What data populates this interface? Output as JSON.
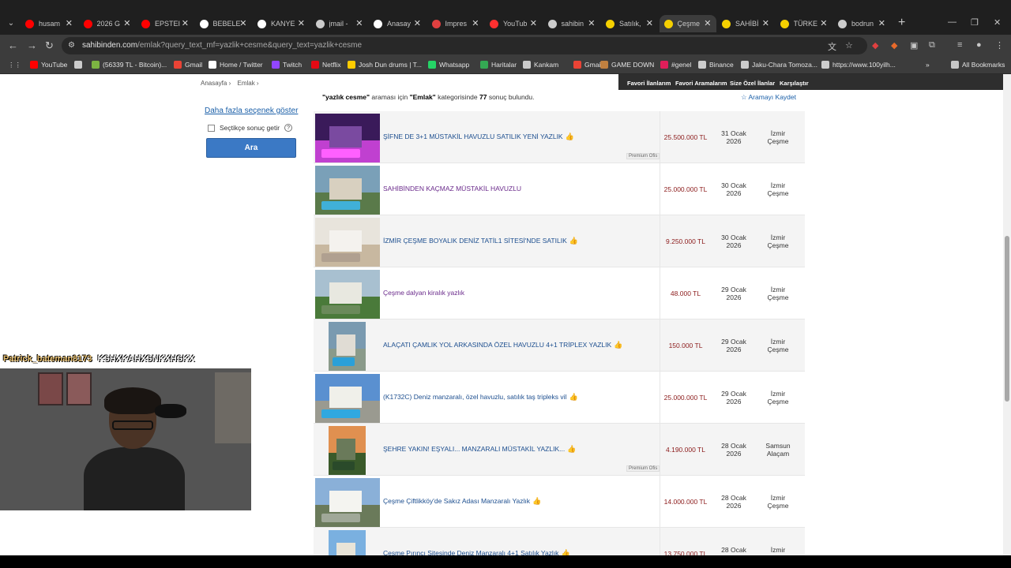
{
  "tabs": [
    {
      "label": "husam",
      "color": "#ff0000"
    },
    {
      "label": "2026 G",
      "color": "#ff0000"
    },
    {
      "label": "EPSTEI",
      "color": "#ff0000"
    },
    {
      "label": "BEBELE",
      "color": "#ffffff"
    },
    {
      "label": "KANYE",
      "color": "#ffffff"
    },
    {
      "label": "jmail -",
      "color": "#cccccc"
    },
    {
      "label": "Anasay",
      "color": "#ffffff"
    },
    {
      "label": "Impres",
      "color": "#e04040"
    },
    {
      "label": "YouTub",
      "color": "#ff3030"
    },
    {
      "label": "sahibin",
      "color": "#cccccc"
    },
    {
      "label": "Satılık,",
      "color": "#f5d000"
    },
    {
      "label": "Çeşme",
      "color": "#f5d000"
    },
    {
      "label": "SAHİBİ",
      "color": "#f5d000"
    },
    {
      "label": "TÜRKE",
      "color": "#f5d000"
    },
    {
      "label": "bodrun",
      "color": "#cccccc"
    }
  ],
  "address": {
    "domain": "sahibinden.com",
    "path": "/emlak?query_text_mf=yazlik+cesme&query_text=yazlik+cesme"
  },
  "bookmarks": [
    {
      "label": "YouTube",
      "color": "#ff0000"
    },
    {
      "label": "",
      "color": "#cccccc"
    },
    {
      "label": "(56339 TL - Bitcoin)...",
      "color": "#7cb342"
    },
    {
      "label": "Gmail",
      "color": "#ea4335"
    },
    {
      "label": "Home / Twitter",
      "color": "#ffffff"
    },
    {
      "label": "Twitch",
      "color": "#9146ff"
    },
    {
      "label": "Netflix",
      "color": "#e50914"
    },
    {
      "label": "Josh Dun drums | T...",
      "color": "#ffcc00"
    },
    {
      "label": "Whatsapp",
      "color": "#25d366"
    },
    {
      "label": "Haritalar",
      "color": "#34a853"
    },
    {
      "label": "Kankam",
      "color": "#cccccc"
    },
    {
      "label": "Gmail",
      "color": "#ea4335"
    },
    {
      "label": "GAME DOWN",
      "color": "#c08040"
    },
    {
      "label": "#genel",
      "color": "#e01e5a"
    },
    {
      "label": "Binance",
      "color": "#cccccc"
    },
    {
      "label": "Jaku-Chara Tomoza...",
      "color": "#cccccc"
    },
    {
      "label": "https://www.100yilh...",
      "color": "#cccccc"
    }
  ],
  "all_bookmarks": "All Bookmarks",
  "breadcrumb": [
    "Anasayfa ›",
    "Emlak ›"
  ],
  "topnav": [
    "Favori İlanlarım",
    "Favori Aramalarım",
    "Size Özel İlanlar",
    "Karşılaştır"
  ],
  "result_info": {
    "query": "\"yazlık cesme\"",
    "mid": " araması için ",
    "category": "\"Emlak\"",
    "mid2": " kategorisinde ",
    "count": "77",
    "tail": " sonuç bulundu."
  },
  "save_search": "☆ Aramayı Kaydet",
  "more_filters": "Daha fazla seçenek göster",
  "select_label": "Seçtikçe sonuç getir",
  "search_button": "Ara",
  "listings": [
    {
      "title": "ŞİFNE DE 3+1 MÜSTAKİL HAVUZLU SATILIK YENİ YAZLIK",
      "price": "25.500.000 TL",
      "date1": "31 Ocak",
      "date2": "2026",
      "loc1": "İzmir",
      "loc2": "Çeşme",
      "premium": "Premium Ofis",
      "thumbsup": true,
      "visited": false,
      "sky": "#3a1a5a",
      "ground": "#c040d0",
      "house": "#7a4aa0",
      "pool": "#ff60ff"
    },
    {
      "title": "SAHİBİNDEN KAÇMAZ MÜSTAKİL HAVUZLU",
      "price": "25.000.000 TL",
      "date1": "30 Ocak",
      "date2": "2026",
      "loc1": "İzmir",
      "loc2": "Çeşme",
      "premium": "",
      "thumbsup": false,
      "visited": true,
      "sky": "#7aa0b8",
      "ground": "#5a7a4a",
      "house": "#d8d0c0",
      "pool": "#40b0d8"
    },
    {
      "title": "İZMİR ÇEŞME BOYALIK DENİZ TATİL1 SİTESİ'NDE SATILIK",
      "price": "9.250.000 TL",
      "date1": "30 Ocak",
      "date2": "2026",
      "loc1": "İzmir",
      "loc2": "Çeşme",
      "premium": "",
      "thumbsup": true,
      "visited": false,
      "sky": "#e8e4dc",
      "ground": "#c8b8a0",
      "house": "#f4f2ee",
      "pool": "#b0a090"
    },
    {
      "title": "Çeşme dalyan kiralık yazlık",
      "price": "48.000 TL",
      "date1": "29 Ocak",
      "date2": "2026",
      "loc1": "İzmir",
      "loc2": "Çeşme",
      "premium": "",
      "thumbsup": false,
      "visited": true,
      "sky": "#a8c0d0",
      "ground": "#4a7a3a",
      "house": "#e8e8e0",
      "pool": "#6a8a5a"
    },
    {
      "title": "ALAÇATI ÇAMLIK YOL ARKASINDA ÖZEL HAVUZLU 4+1 TRİPLEX YAZLIK",
      "price": "150.000 TL",
      "date1": "29 Ocak",
      "date2": "2026",
      "loc1": "İzmir",
      "loc2": "Çeşme",
      "premium": "",
      "thumbsup": true,
      "visited": false,
      "narrow": true,
      "sky": "#7a9ab0",
      "ground": "#8a9a8a",
      "house": "#e0dcd4",
      "pool": "#2aa0d8"
    },
    {
      "title": "(K1732C) Deniz manzaralı, özel havuzlu, satılık taş tripleks vil",
      "price": "25.000.000 TL",
      "date1": "29 Ocak",
      "date2": "2026",
      "loc1": "İzmir",
      "loc2": "Çeşme",
      "premium": "",
      "thumbsup": true,
      "visited": false,
      "sky": "#5a90d0",
      "ground": "#9a9a90",
      "house": "#f0f0ea",
      "pool": "#30a8e0"
    },
    {
      "title": "ŞEHRE YAKIN! EŞYALI... MANZARALI MÜSTAKİL YAZLIK...",
      "price": "4.190.000 TL",
      "date1": "28 Ocak",
      "date2": "2026",
      "loc1": "Samsun",
      "loc2": "Alaçam",
      "premium": "Premium Ofis",
      "thumbsup": true,
      "visited": false,
      "narrow": true,
      "sky": "#e09050",
      "ground": "#3a5a2a",
      "house": "#6a7a5a",
      "pool": "#2a4a2a"
    },
    {
      "title": "Çeşme Çiftlikköy'de Sakız Adası Manzaralı Yazlık",
      "price": "14.000.000 TL",
      "date1": "28 Ocak",
      "date2": "2026",
      "loc1": "İzmir",
      "loc2": "Çeşme",
      "premium": "",
      "thumbsup": true,
      "visited": false,
      "sky": "#8ab0d8",
      "ground": "#6a7a5a",
      "house": "#f4f4f0",
      "pool": "#a0a898"
    },
    {
      "title": "Çeşme Pırıncı Sitesinde Deniz Manzaralı 4+1 Satılık Yazlık",
      "price": "13.750.000 TL",
      "date1": "28 Ocak",
      "date2": "2026",
      "loc1": "İzmir",
      "loc2": "Çeşme",
      "premium": "",
      "thumbsup": true,
      "visited": false,
      "narrow": true,
      "sky": "#7ab0e0",
      "ground": "#8a8a70",
      "house": "#e8e4d8",
      "pool": "#5a7a5a"
    }
  ],
  "stream": {
    "user": "Patrick_bateman8173",
    "message": "KSHXKAHXSNKXHSKX"
  }
}
